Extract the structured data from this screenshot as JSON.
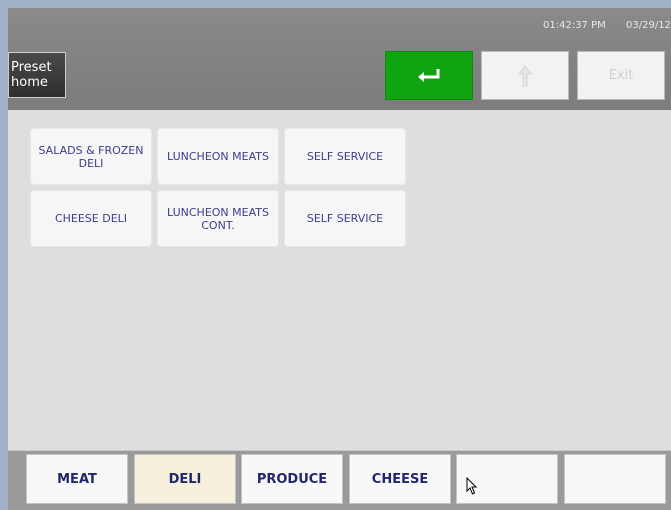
{
  "header": {
    "time": "01:42:37 PM",
    "date": "03/29/12",
    "preset_line1": "Preset",
    "preset_line2": "home",
    "exit_label": "Exit",
    "enter_icon": "enter-arrow-icon",
    "up_icon": "up-arrow-icon",
    "enter_color": "#10a510"
  },
  "categories": [
    "SALADS & FROZEN DELI",
    "LUNCHEON MEATS",
    "SELF SERVICE",
    "CHEESE DELI",
    "LUNCHEON MEATS CONT.",
    "SELF SERVICE"
  ],
  "tabs": [
    "MEAT",
    "DELI",
    "PRODUCE",
    "CHEESE",
    "",
    ""
  ],
  "active_tab": "DELI"
}
